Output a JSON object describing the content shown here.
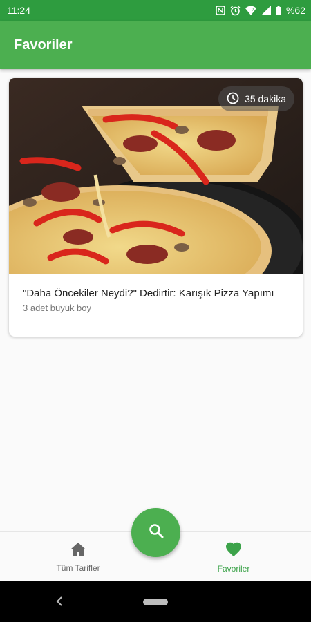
{
  "status_bar": {
    "time": "11:24",
    "battery": "%62",
    "icons": [
      "nfc-icon",
      "alarm-icon",
      "wifi-icon",
      "signal-icon",
      "battery-icon"
    ]
  },
  "app_bar": {
    "title": "Favoriler"
  },
  "recipes": [
    {
      "title": "\"Daha Öncekiler Neydi?\" Dedirtir: Karışık Pizza Yapımı",
      "subtitle": "3 adet büyük boy",
      "duration": "35 dakika",
      "image": "pizza-image"
    }
  ],
  "bottom_nav": {
    "items": [
      {
        "label": "Tüm Tarifler",
        "icon": "home-icon",
        "active": false
      },
      {
        "label": "Favoriler",
        "icon": "heart-icon",
        "active": true
      }
    ]
  },
  "fab": {
    "icon": "search-icon"
  },
  "colors": {
    "primary": "#4caf50",
    "primary_dark": "#2e9c3f",
    "active_nav": "#3ca34a",
    "inactive_nav": "#666666"
  }
}
